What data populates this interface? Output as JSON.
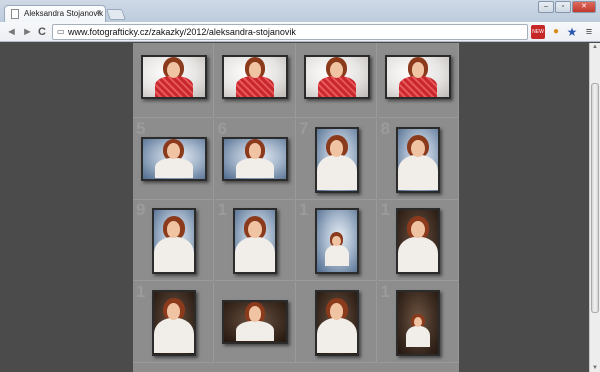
{
  "browser": {
    "tab_title": "Aleksandra Stojanovik",
    "tab_close": "×",
    "url": "www.fotografticky.cz/zakazky/2012/aleksandra-stojanovik",
    "back_icon": "◄",
    "forward_icon": "►",
    "reload_icon": "C",
    "window_controls": [
      "–",
      "▫",
      "✕"
    ],
    "extensions": {
      "new_badge": "NEW",
      "cookie": "●",
      "star": "★",
      "menu": "≡"
    }
  },
  "gallery": {
    "cells": [
      {
        "num": "",
        "bg": "light",
        "shirt": "red",
        "orientation": "landscape"
      },
      {
        "num": "",
        "bg": "light",
        "shirt": "red",
        "orientation": "landscape"
      },
      {
        "num": "",
        "bg": "light",
        "shirt": "red",
        "orientation": "landscape"
      },
      {
        "num": "",
        "bg": "light",
        "shirt": "red",
        "orientation": "landscape"
      },
      {
        "num": "5",
        "bg": "blue",
        "shirt": "white",
        "orientation": "landscape"
      },
      {
        "num": "6",
        "bg": "blue",
        "shirt": "white",
        "orientation": "landscape"
      },
      {
        "num": "7",
        "bg": "blue",
        "shirt": "white",
        "orientation": "portrait"
      },
      {
        "num": "8",
        "bg": "blue",
        "shirt": "white",
        "orientation": "portrait"
      },
      {
        "num": "9",
        "bg": "blue",
        "shirt": "white",
        "orientation": "portrait"
      },
      {
        "num": "1",
        "bg": "blue",
        "shirt": "white",
        "orientation": "portrait"
      },
      {
        "num": "1",
        "bg": "blue",
        "shirt": "white",
        "orientation": "portrait-full"
      },
      {
        "num": "1",
        "bg": "brown",
        "shirt": "white",
        "orientation": "portrait"
      },
      {
        "num": "1",
        "bg": "brown",
        "shirt": "white",
        "orientation": "portrait"
      },
      {
        "num": "",
        "bg": "brown",
        "shirt": "white",
        "orientation": "landscape"
      },
      {
        "num": "",
        "bg": "brown",
        "shirt": "white",
        "orientation": "portrait"
      },
      {
        "num": "1",
        "bg": "brown",
        "shirt": "white",
        "orientation": "portrait-full"
      }
    ]
  }
}
